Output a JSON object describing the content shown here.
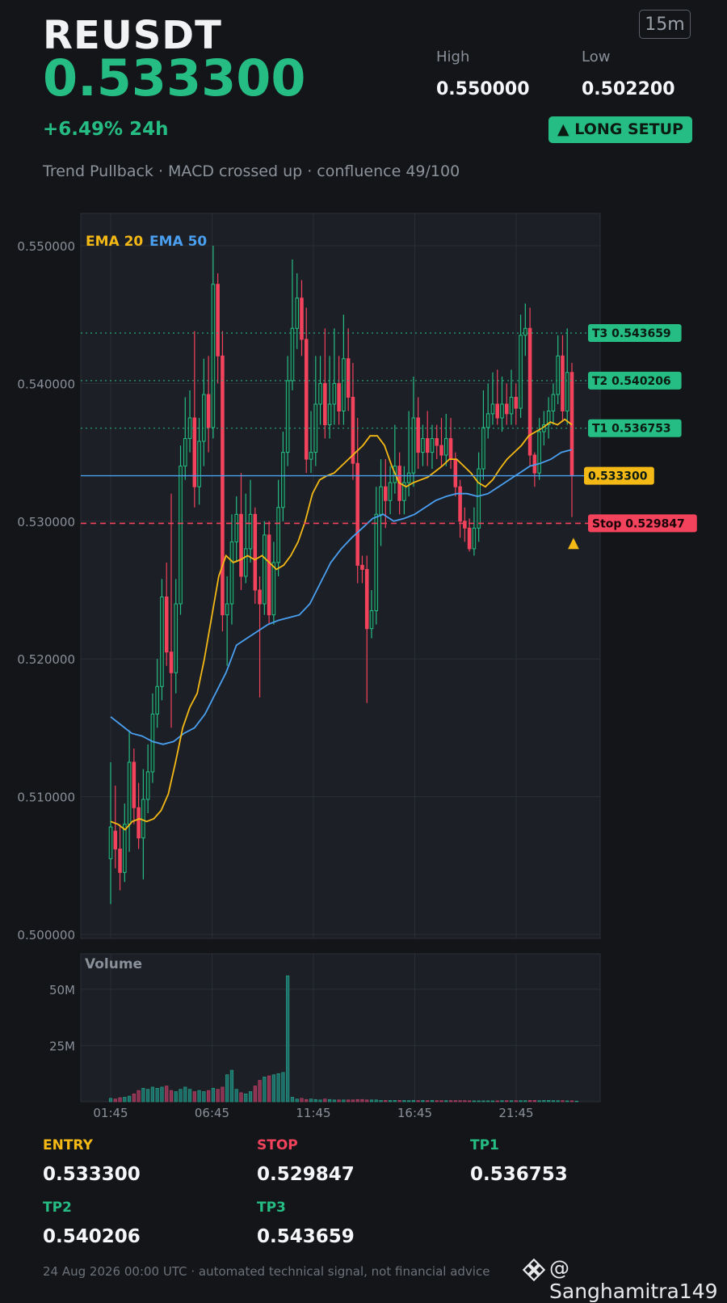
{
  "header": {
    "symbol": "REUSDT",
    "price": "0.533300",
    "timeframe": "15m",
    "high_label": "High",
    "high_value": "0.550000",
    "low_label": "Low",
    "low_value": "0.502200",
    "change": "+6.49%  24h",
    "setup_badge": "▲ LONG SETUP",
    "subtitle": "Trend Pullback · MACD crossed up · confluence 49/100"
  },
  "colors": {
    "up": "#26bd84",
    "down": "#f2425c",
    "ema20": "#f5b915",
    "ema50": "#4a9ff0",
    "background": "#131519",
    "panel": "#1c1f26"
  },
  "chart_data": {
    "type": "candlestick",
    "price_axis": {
      "ylim": [
        0.5,
        0.55
      ],
      "ticks": [
        "0.550000",
        "0.540000",
        "0.530000",
        "0.520000",
        "0.510000",
        "0.500000"
      ],
      "tick_values": [
        0.55,
        0.54,
        0.53,
        0.52,
        0.51,
        0.5
      ]
    },
    "time_ticks": [
      "01:45",
      "06:45",
      "11:45",
      "16:45",
      "21:45"
    ],
    "legend": {
      "ema20": "EMA 20",
      "ema50": "EMA 50",
      "placement": "top-left"
    },
    "grid": true,
    "candles": [
      [
        0.5055,
        0.5078,
        0.5022,
        0.5125
      ],
      [
        0.5075,
        0.5062,
        0.5048,
        0.5108
      ],
      [
        0.5062,
        0.5045,
        0.5032,
        0.508
      ],
      [
        0.5045,
        0.508,
        0.5038,
        0.5095
      ],
      [
        0.508,
        0.5125,
        0.506,
        0.5148
      ],
      [
        0.5125,
        0.5092,
        0.508,
        0.5135
      ],
      [
        0.5092,
        0.507,
        0.5062,
        0.511
      ],
      [
        0.507,
        0.5098,
        0.504,
        0.512
      ],
      [
        0.5098,
        0.5118,
        0.5088,
        0.5138
      ],
      [
        0.5118,
        0.516,
        0.511,
        0.5175
      ],
      [
        0.516,
        0.518,
        0.515,
        0.52
      ],
      [
        0.518,
        0.5245,
        0.517,
        0.5258
      ],
      [
        0.5245,
        0.5205,
        0.5195,
        0.527
      ],
      [
        0.5205,
        0.519,
        0.515,
        0.532
      ],
      [
        0.519,
        0.524,
        0.5175,
        0.5258
      ],
      [
        0.524,
        0.534,
        0.5232,
        0.5355
      ],
      [
        0.534,
        0.536,
        0.533,
        0.539
      ],
      [
        0.536,
        0.5375,
        0.535,
        0.5395
      ],
      [
        0.5375,
        0.5325,
        0.531,
        0.5438
      ],
      [
        0.5325,
        0.5358,
        0.5312,
        0.5375
      ],
      [
        0.5358,
        0.5392,
        0.534,
        0.5418
      ],
      [
        0.5392,
        0.5368,
        0.535,
        0.542
      ],
      [
        0.5368,
        0.5472,
        0.536,
        0.55
      ],
      [
        0.5472,
        0.542,
        0.54,
        0.548
      ],
      [
        0.542,
        0.5232,
        0.522,
        0.5438
      ],
      [
        0.5232,
        0.524,
        0.5195,
        0.526
      ],
      [
        0.524,
        0.5285,
        0.5225,
        0.5305
      ],
      [
        0.5285,
        0.5305,
        0.527,
        0.5318
      ],
      [
        0.5305,
        0.526,
        0.525,
        0.5335
      ],
      [
        0.526,
        0.528,
        0.5255,
        0.532
      ],
      [
        0.528,
        0.5305,
        0.527,
        0.533
      ],
      [
        0.5305,
        0.525,
        0.524,
        0.531
      ],
      [
        0.525,
        0.524,
        0.5172,
        0.526
      ],
      [
        0.524,
        0.529,
        0.5232,
        0.53
      ],
      [
        0.529,
        0.5232,
        0.5225,
        0.53
      ],
      [
        0.5232,
        0.527,
        0.5225,
        0.5285
      ],
      [
        0.527,
        0.531,
        0.526,
        0.533
      ],
      [
        0.531,
        0.535,
        0.53,
        0.5365
      ],
      [
        0.535,
        0.5402,
        0.534,
        0.542
      ],
      [
        0.5402,
        0.544,
        0.5395,
        0.549
      ],
      [
        0.544,
        0.5462,
        0.5425,
        0.548
      ],
      [
        0.5462,
        0.5432,
        0.542,
        0.5475
      ],
      [
        0.5432,
        0.5345,
        0.5335,
        0.5455
      ],
      [
        0.5345,
        0.535,
        0.5335,
        0.538
      ],
      [
        0.535,
        0.5385,
        0.534,
        0.542
      ],
      [
        0.5385,
        0.54,
        0.537,
        0.542
      ],
      [
        0.54,
        0.537,
        0.536,
        0.544
      ],
      [
        0.537,
        0.5385,
        0.536,
        0.542
      ],
      [
        0.5385,
        0.54,
        0.537,
        0.544
      ],
      [
        0.54,
        0.538,
        0.537,
        0.542
      ],
      [
        0.538,
        0.5418,
        0.537,
        0.545
      ],
      [
        0.5418,
        0.539,
        0.538,
        0.544
      ],
      [
        0.539,
        0.5342,
        0.533,
        0.5415
      ],
      [
        0.5342,
        0.5268,
        0.5255,
        0.5375
      ],
      [
        0.5268,
        0.5265,
        0.5255,
        0.5275
      ],
      [
        0.5265,
        0.5222,
        0.5168,
        0.5275
      ],
      [
        0.5222,
        0.5235,
        0.5215,
        0.525
      ],
      [
        0.5235,
        0.5305,
        0.5225,
        0.5325
      ],
      [
        0.5305,
        0.5325,
        0.5282,
        0.5345
      ],
      [
        0.5325,
        0.5315,
        0.5295,
        0.5345
      ],
      [
        0.5315,
        0.5328,
        0.5305,
        0.534
      ],
      [
        0.5328,
        0.534,
        0.532,
        0.537
      ],
      [
        0.534,
        0.5315,
        0.5305,
        0.535
      ],
      [
        0.5315,
        0.5328,
        0.5305,
        0.534
      ],
      [
        0.5328,
        0.5335,
        0.5318,
        0.538
      ],
      [
        0.5335,
        0.5375,
        0.5325,
        0.5405
      ],
      [
        0.5375,
        0.535,
        0.5338,
        0.539
      ],
      [
        0.535,
        0.536,
        0.534,
        0.537
      ],
      [
        0.536,
        0.535,
        0.534,
        0.538
      ],
      [
        0.535,
        0.536,
        0.5338,
        0.537
      ],
      [
        0.536,
        0.5355,
        0.5345,
        0.537
      ],
      [
        0.5355,
        0.5348,
        0.534,
        0.5375
      ],
      [
        0.5348,
        0.536,
        0.534,
        0.5378
      ],
      [
        0.536,
        0.5345,
        0.5338,
        0.5375
      ],
      [
        0.5345,
        0.5325,
        0.5318,
        0.535
      ],
      [
        0.5325,
        0.53,
        0.5288,
        0.533
      ],
      [
        0.53,
        0.5295,
        0.5285,
        0.531
      ],
      [
        0.5295,
        0.528,
        0.5278,
        0.5302
      ],
      [
        0.528,
        0.5295,
        0.5275,
        0.531
      ],
      [
        0.5295,
        0.5338,
        0.5285,
        0.535
      ],
      [
        0.5338,
        0.5368,
        0.533,
        0.5395
      ],
      [
        0.5368,
        0.5378,
        0.536,
        0.54
      ],
      [
        0.5378,
        0.5385,
        0.537,
        0.5408
      ],
      [
        0.5385,
        0.5375,
        0.537,
        0.541
      ],
      [
        0.5375,
        0.5385,
        0.5365,
        0.5405
      ],
      [
        0.5385,
        0.5378,
        0.537,
        0.54
      ],
      [
        0.5378,
        0.539,
        0.537,
        0.541
      ],
      [
        0.539,
        0.5382,
        0.537,
        0.54
      ],
      [
        0.5382,
        0.5435,
        0.5375,
        0.545
      ],
      [
        0.5435,
        0.544,
        0.542,
        0.5458
      ],
      [
        0.544,
        0.5348,
        0.534,
        0.5455
      ],
      [
        0.5348,
        0.5335,
        0.5325,
        0.535
      ],
      [
        0.5335,
        0.5365,
        0.533,
        0.5375
      ],
      [
        0.5365,
        0.537,
        0.5355,
        0.538
      ],
      [
        0.537,
        0.538,
        0.536,
        0.539
      ],
      [
        0.538,
        0.5392,
        0.537,
        0.54
      ],
      [
        0.5392,
        0.542,
        0.5385,
        0.5435
      ],
      [
        0.542,
        0.538,
        0.5372,
        0.5435
      ],
      [
        0.538,
        0.5408,
        0.537,
        0.544
      ],
      [
        0.5408,
        0.5333,
        0.5303,
        0.5415
      ]
    ],
    "ema20": [
      0.5082,
      0.508,
      0.5076,
      0.5082,
      0.5084,
      0.5082,
      0.5084,
      0.509,
      0.5102,
      0.5125,
      0.515,
      0.5165,
      0.5175,
      0.52,
      0.523,
      0.526,
      0.5275,
      0.527,
      0.5272,
      0.5275,
      0.5272,
      0.5275,
      0.527,
      0.5265,
      0.5268,
      0.5275,
      0.5285,
      0.53,
      0.532,
      0.533,
      0.5333,
      0.5335,
      0.534,
      0.5345,
      0.535,
      0.5355,
      0.5362,
      0.5362,
      0.5355,
      0.534,
      0.5328,
      0.5325,
      0.5328,
      0.533,
      0.5332,
      0.5336,
      0.534,
      0.5345,
      0.5345,
      0.534,
      0.5335,
      0.5328,
      0.5325,
      0.533,
      0.5338,
      0.5345,
      0.535,
      0.5355,
      0.5362,
      0.5365,
      0.5368,
      0.5372,
      0.537,
      0.5374,
      0.537
    ],
    "ema50": [
      0.5158,
      0.5152,
      0.5146,
      0.5144,
      0.514,
      0.5138,
      0.514,
      0.5146,
      0.515,
      0.516,
      0.5175,
      0.519,
      0.521,
      0.5215,
      0.522,
      0.5225,
      0.5228,
      0.523,
      0.5232,
      0.524,
      0.5255,
      0.527,
      0.528,
      0.5288,
      0.5295,
      0.5302,
      0.5305,
      0.53,
      0.5302,
      0.5305,
      0.531,
      0.5315,
      0.5318,
      0.532,
      0.532,
      0.5318,
      0.532,
      0.5325,
      0.533,
      0.5335,
      0.534,
      0.5342,
      0.5345,
      0.535,
      0.5352
    ],
    "levels": [
      {
        "key": "t3",
        "label": "T3 0.543659",
        "value": 0.543659,
        "color": "#26bd84",
        "style": "dotted"
      },
      {
        "key": "t2",
        "label": "T2 0.540206",
        "value": 0.540206,
        "color": "#26bd84",
        "style": "dotted"
      },
      {
        "key": "t1",
        "label": "T1 0.536753",
        "value": 0.536753,
        "color": "#26bd84",
        "style": "dotted"
      },
      {
        "key": "current",
        "label": "0.533300",
        "value": 0.5333,
        "color": "#f5b915",
        "line_color": "#4a9ff0",
        "style": "solid"
      },
      {
        "key": "stop",
        "label": "Stop 0.529847",
        "value": 0.529847,
        "color": "#f2425c",
        "style": "dashed"
      }
    ],
    "volume": {
      "label": "Volume",
      "ticks": [
        "50M",
        "25M"
      ],
      "tick_values": [
        50,
        25
      ],
      "ylim": [
        0,
        60
      ],
      "values_m": [
        1.5,
        1.2,
        1.8,
        2.0,
        2.5,
        3.5,
        5.0,
        6.0,
        5.5,
        6.5,
        6.0,
        6.5,
        7.0,
        5.0,
        4.5,
        5.5,
        6.5,
        5.5,
        4.5,
        5.0,
        4.5,
        5.0,
        6.0,
        5.5,
        6.5,
        12.0,
        14.0,
        5.5,
        4.0,
        3.5,
        4.5,
        7.0,
        9.5,
        11.0,
        11.5,
        12.0,
        12.5,
        13.0,
        56.0,
        2.0,
        1.2,
        1.5,
        1.0,
        1.2,
        1.0,
        0.8,
        1.2,
        1.0,
        0.8,
        0.8,
        0.8,
        0.8,
        0.8,
        1.0,
        1.0,
        0.8,
        0.8,
        0.8,
        0.6,
        0.6,
        0.6,
        0.6,
        0.6,
        0.6,
        0.5,
        0.6,
        0.5,
        0.6,
        0.5,
        0.6,
        0.5,
        0.5,
        0.5,
        0.5,
        0.5,
        0.5,
        0.5,
        0.4,
        0.4,
        0.4,
        0.4,
        0.4,
        0.4,
        0.4,
        0.5,
        0.5,
        0.5,
        0.5,
        0.5,
        0.5,
        0.6,
        0.6,
        0.5,
        0.6,
        0.6,
        0.5,
        0.5,
        0.5,
        0.4,
        0.4,
        0.3
      ]
    }
  },
  "levels_panel": {
    "entry_label": "ENTRY",
    "entry_value": "0.533300",
    "stop_label": "STOP",
    "stop_value": "0.529847",
    "tp1_label": "TP1",
    "tp1_value": "0.536753",
    "tp2_label": "TP2",
    "tp2_value": "0.540206",
    "tp3_label": "TP3",
    "tp3_value": "0.543659"
  },
  "footer": {
    "disclaimer": "24 Aug 2026 00:00 UTC  ·  automated technical signal, not financial advice",
    "brand": "@ Sanghamitra149",
    "brand_icon": "binance-logo-icon"
  }
}
